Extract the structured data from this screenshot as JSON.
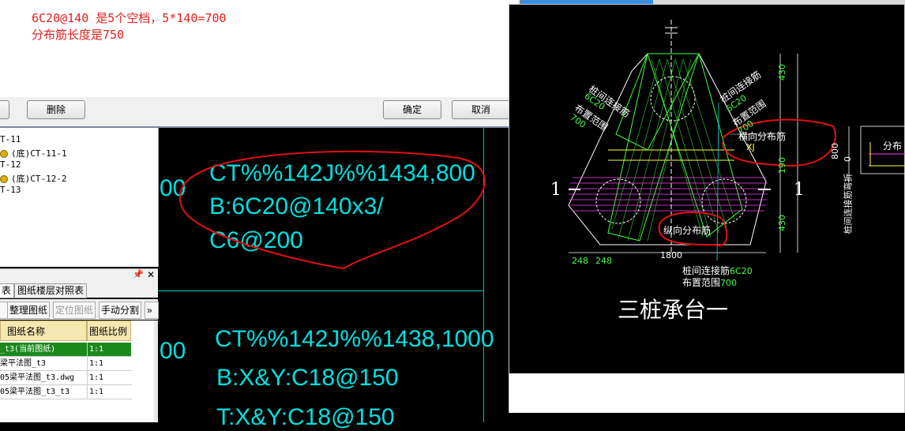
{
  "dialog": {
    "line1": "6C20@140 是5个空档，5*140=700",
    "line2": "分布筋长度是750",
    "delete_label": "删除",
    "ok_label": "确定",
    "cancel_label": "取消"
  },
  "tree": {
    "items": [
      {
        "label": "T-11",
        "dot": false
      },
      {
        "label": "(底)CT-11-1",
        "dot": true
      },
      {
        "label": "T-12",
        "dot": false
      },
      {
        "label": "(底)CT-12-2",
        "dot": true
      },
      {
        "label": "T-13",
        "dot": false
      }
    ]
  },
  "panel": {
    "pin_icon": "pin-icon",
    "close_icon": "close-icon",
    "tab1": "表",
    "tab2": "图纸楼层对照表",
    "tools": [
      "整理图纸",
      "定位图纸",
      "手动分割"
    ],
    "more": "»"
  },
  "table": {
    "headers": [
      "图纸名称",
      "图纸比例"
    ],
    "rows": [
      {
        "name": "_t3(当前图纸)",
        "scale": "1:1",
        "current": true
      },
      {
        "name": "梁平法图_t3",
        "scale": "1:1",
        "current": false
      },
      {
        "name": "05梁平法图_t3.dwg",
        "scale": "1:1",
        "current": false
      },
      {
        "name": "05梁平法图_t3_t3",
        "scale": "1:1",
        "current": false
      }
    ]
  },
  "cad": {
    "frag1": "00",
    "frag2": "00",
    "block1": {
      "l1": "CT%%142J%%1434,800",
      "l2": "B:6C20@140x3/",
      "l3": "C6@200"
    },
    "block2": {
      "l1": "CT%%142J%%1438,1000",
      "l2": "B:X&Y:C18@150",
      "l3": "T:X&Y:C18@150"
    }
  },
  "drawing": {
    "title": "三桩承台一",
    "section_left": "1",
    "section_right": "1",
    "label_left_1": "桩间连接筋",
    "label_left_2": "6C20",
    "label_left_3": "布置范围",
    "label_left_4": "700",
    "label_right_1": "桩间连接筋",
    "label_right_2": "6C20",
    "label_right_3": "布置范围",
    "label_right_4": "700",
    "label_bottom_1": "桩间连接筋",
    "label_bottom_2": "6C20",
    "label_bottom_3": "布置范围",
    "label_bottom_4": "700",
    "horiz_dist": "横向分布筋",
    "xj": "XJ",
    "long_dist": "纵向分布筋",
    "dim_430_top": "430",
    "dim_190": "190",
    "dim_430_bot": "430",
    "dim_248a": "248",
    "dim_248b": "248",
    "dim_1800": "1800",
    "dim_800": "800",
    "dim_0": "0",
    "side_label": "桩间连接筋弯折",
    "side_dist": "分布"
  },
  "colors": {
    "cyan": "#00e0e0",
    "green": "#40ff40",
    "magenta": "#ff40ff",
    "red_annot": "#e01010",
    "current_row": "#1a8a1a"
  }
}
